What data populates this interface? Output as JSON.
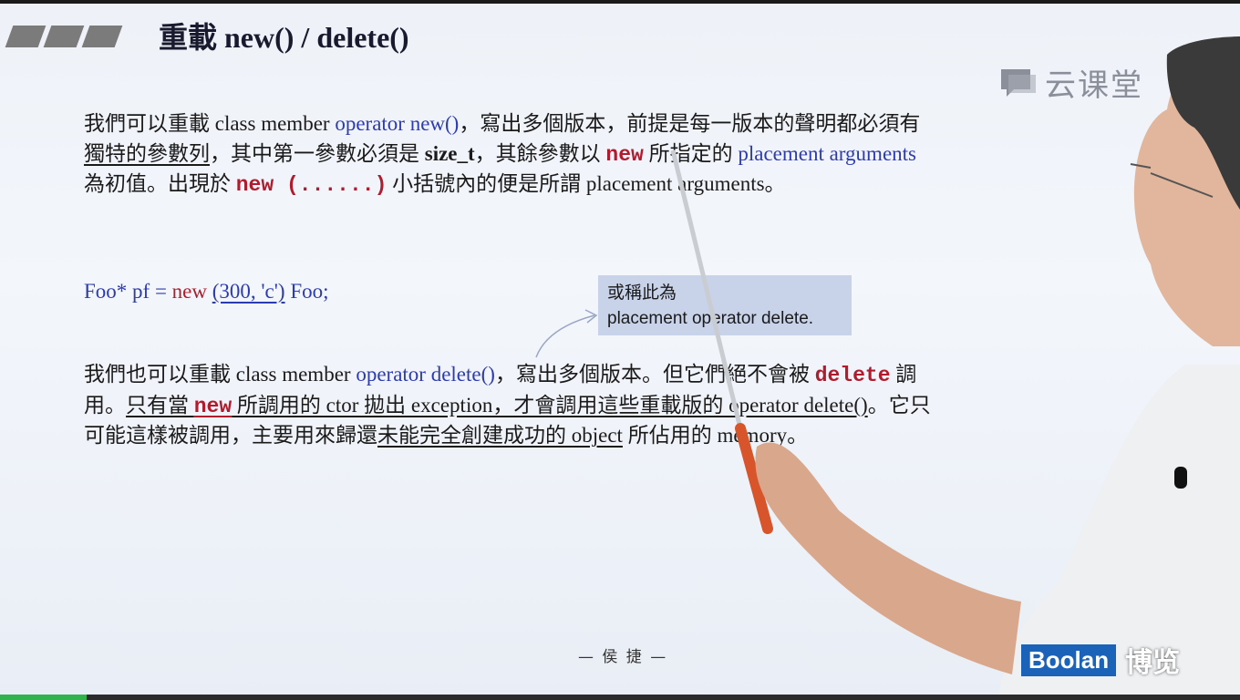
{
  "slide": {
    "title": "重載 new() / delete()",
    "watermark": "云课堂",
    "author": "— 侯 捷 —",
    "brand_en": "Boolan",
    "brand_cn": "博览",
    "progress_percent": 7
  },
  "para1": {
    "t1": "我們可以重載 class member ",
    "t2": "operator new()",
    "t3": "，寫出多個版本，前提是每一版本的聲明都必須有",
    "t4": "獨特的參數列",
    "t5": "，其中第一參數必須是 ",
    "t6": "size_t",
    "t7": "，其餘參數以 ",
    "t8": "new",
    "t9": " 所指定的 ",
    "t10": "placement arguments",
    "t11": " 為初值。出現於 ",
    "t12": "new (......)",
    "t13": " 小括號內的便是所謂 placement arguments。"
  },
  "code_line": {
    "c1": "Foo* pf = ",
    "c2": "new",
    "c3": "(300, 'c')",
    "c4": " Foo;"
  },
  "note": {
    "line1": "或稱此為",
    "line2": "placement operator delete."
  },
  "para2": {
    "t1": "我們也可以重載 class member ",
    "t2": "operator delete()",
    "t3": "，寫出多個版本。但它們絕不會被 ",
    "t4": "delete",
    "t5": " 調用。",
    "t6": "只有當 ",
    "t7": "new",
    "t8": " 所調用的 ctor 拋出 exception，才會調用這些重載版的 operator delete()",
    "t9": "。它只可能這樣被調用，主要用來歸還",
    "t10": "未能完全創建成功的 object",
    "t11": " 所佔用的 memory。"
  }
}
